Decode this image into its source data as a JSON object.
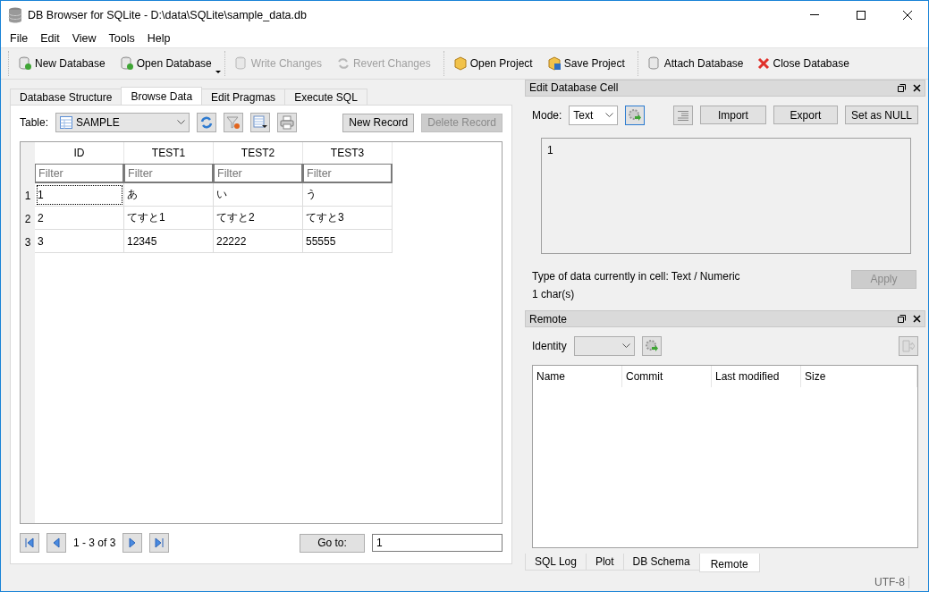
{
  "window": {
    "title": "DB Browser for SQLite - D:\\data\\SQLite\\sample_data.db"
  },
  "menu": [
    "File",
    "Edit",
    "View",
    "Tools",
    "Help"
  ],
  "toolbar": {
    "groups": [
      [
        {
          "label": "New Database",
          "kind": "new-db",
          "disabled": false,
          "has_menu": false
        },
        {
          "label": "Open Database",
          "kind": "open-db",
          "disabled": false,
          "has_menu": true
        }
      ],
      [
        {
          "label": "Write Changes",
          "kind": "write",
          "disabled": true,
          "has_menu": false
        },
        {
          "label": "Revert Changes",
          "kind": "revert",
          "disabled": true,
          "has_menu": false
        }
      ],
      [
        {
          "label": "Open Project",
          "kind": "open-project",
          "disabled": false,
          "has_menu": false
        },
        {
          "label": "Save Project",
          "kind": "save-project",
          "disabled": false,
          "has_menu": false
        }
      ],
      [
        {
          "label": "Attach Database",
          "kind": "attach",
          "disabled": false,
          "has_menu": false
        },
        {
          "label": "Close Database",
          "kind": "close-db",
          "disabled": false,
          "has_menu": false
        }
      ]
    ]
  },
  "tabs": [
    {
      "label": "Database Structure",
      "selected": false
    },
    {
      "label": "Browse Data",
      "selected": true
    },
    {
      "label": "Edit Pragmas",
      "selected": false
    },
    {
      "label": "Execute SQL",
      "selected": false
    }
  ],
  "browse": {
    "table_label": "Table:",
    "table_value": "SAMPLE",
    "new_record": {
      "label": "New Record",
      "disabled": false
    },
    "delete_record": {
      "label": "Delete Record",
      "disabled": true
    },
    "columns": [
      {
        "name": "ID",
        "filter_placeholder": "Filter"
      },
      {
        "name": "TEST1",
        "filter_placeholder": "Filter"
      },
      {
        "name": "TEST2",
        "filter_placeholder": "Filter"
      },
      {
        "name": "TEST3",
        "filter_placeholder": "Filter"
      }
    ],
    "rows": [
      {
        "number": "1",
        "cells": [
          {
            "text": "1",
            "focused": true
          },
          {
            "text": "あ",
            "focused": false
          },
          {
            "text": "い",
            "focused": false
          },
          {
            "text": "う",
            "focused": false
          }
        ]
      },
      {
        "number": "2",
        "cells": [
          {
            "text": "2",
            "focused": false
          },
          {
            "text": "てすと1",
            "focused": false
          },
          {
            "text": "てすと2",
            "focused": false
          },
          {
            "text": "てすと3",
            "focused": false
          }
        ]
      },
      {
        "number": "3",
        "cells": [
          {
            "text": "3",
            "focused": false
          },
          {
            "text": "12345",
            "focused": false
          },
          {
            "text": "22222",
            "focused": false
          },
          {
            "text": "55555",
            "focused": false
          }
        ]
      }
    ],
    "range": "1 - 3 of 3",
    "goto_label": "Go to:",
    "goto_value": "1"
  },
  "edit_cell": {
    "title": "Edit Database Cell",
    "mode_label": "Mode:",
    "mode_value": "Text",
    "buttons": [
      "Import",
      "Export",
      "Set as NULL"
    ],
    "value": "1",
    "type_info": "Type of data currently in cell: Text / Numeric",
    "size_info": "1 char(s)",
    "apply": {
      "label": "Apply",
      "disabled": true
    }
  },
  "remote": {
    "title": "Remote",
    "identity_label": "Identity",
    "columns": [
      "Name",
      "Commit",
      "Last modified",
      "Size"
    ]
  },
  "bottom_tabs": [
    {
      "label": "SQL Log",
      "selected": false
    },
    {
      "label": "Plot",
      "selected": false
    },
    {
      "label": "DB Schema",
      "selected": false
    },
    {
      "label": "Remote",
      "selected": true
    }
  ],
  "status": "UTF-8"
}
